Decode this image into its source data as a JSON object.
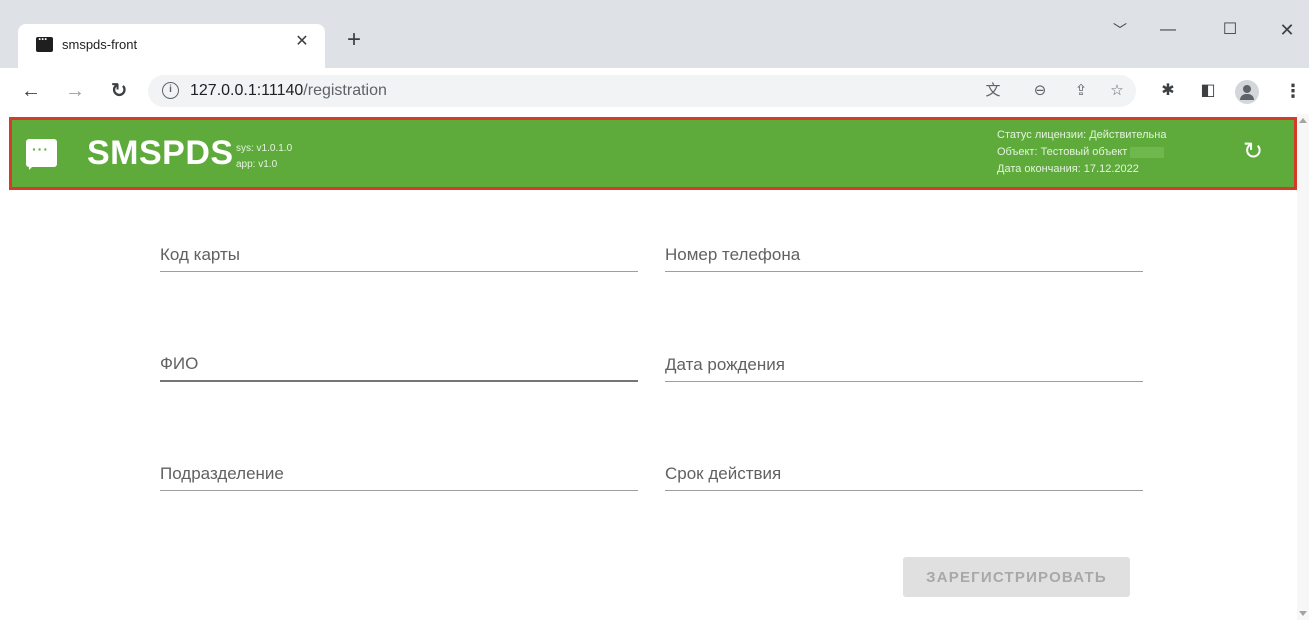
{
  "browser": {
    "tab_title": "smspds-front",
    "tab_close": "✕",
    "new_tab": "+",
    "url_host": "127.0.0.1:11140",
    "url_path": "/registration",
    "icons": [
      "translate-icon",
      "zoom-out-icon",
      "share-icon",
      "bookmark-star-icon",
      "extensions-icon",
      "side-panel-icon",
      "profile-icon",
      "menu-icon"
    ]
  },
  "header": {
    "title": "SMSPDS",
    "sys_version": "sys: v1.0.1.0",
    "app_version": "app: v1.0",
    "license_status": "Статус лицензии: Действительна",
    "object": "Объект: Тестовый объект",
    "expiry": "Дата окончания: 17.12.2022",
    "bg_color": "#5eab3c",
    "highlight_border": "#d53b2b"
  },
  "form": {
    "card_code_placeholder": "Код карты",
    "phone_placeholder": "Номер телефона",
    "full_name_placeholder": "ФИО",
    "birth_date_placeholder": "Дата рождения",
    "department_placeholder": "Подразделение",
    "validity_placeholder": "Срок действия",
    "register_label": "ЗАРЕГИСТРИРОВАТЬ",
    "register_disabled": true
  }
}
